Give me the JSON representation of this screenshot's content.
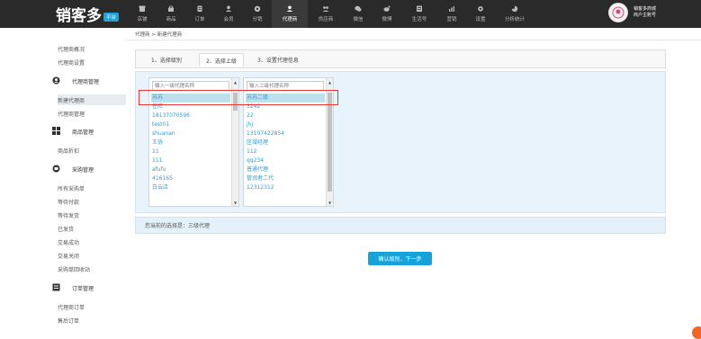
{
  "brand": {
    "name": "销客多",
    "badge": "平台"
  },
  "nav": [
    {
      "label": "店铺",
      "icon": "store-icon"
    },
    {
      "label": "商品",
      "icon": "bag-icon"
    },
    {
      "label": "订单",
      "icon": "order-icon"
    },
    {
      "label": "会员",
      "icon": "member-icon"
    },
    {
      "label": "分销",
      "icon": "distribution-icon"
    },
    {
      "label": "代理商",
      "icon": "agent-icon",
      "active": true
    },
    {
      "label": "供应商",
      "icon": "supplier-icon"
    },
    {
      "label": "微信",
      "icon": "wechat-icon"
    },
    {
      "label": "微博",
      "icon": "weibo-icon"
    },
    {
      "label": "生活号",
      "icon": "life-icon"
    },
    {
      "label": "营销",
      "icon": "marketing-icon"
    },
    {
      "label": "设置",
      "icon": "gear-icon"
    },
    {
      "label": "分析统计",
      "icon": "stats-icon"
    }
  ],
  "user": {
    "line1": "销客多商城",
    "line2": "商户主账号"
  },
  "sidebar": {
    "top_links": [
      "代理商概况",
      "代理商设置"
    ],
    "groups": [
      {
        "title": "代理商管理",
        "icon": "agent-mgmt-icon",
        "links": [
          "新建代理商",
          "代理商管理"
        ]
      },
      {
        "title": "商品管理",
        "icon": "grid-icon",
        "links": [
          "商品折扣"
        ]
      },
      {
        "title": "采购管理",
        "icon": "purchase-icon",
        "links": [
          "所有采购单",
          "等待付款",
          "等待发货",
          "已发货",
          "交易成功",
          "交易关闭",
          "采购单回收站"
        ]
      },
      {
        "title": "订单管理",
        "icon": "doc-icon",
        "links": [
          "代理商订单",
          "售后订单"
        ]
      }
    ],
    "active": "新建代理商"
  },
  "breadcrumb": "代理商 > 新建代理商",
  "tabs": [
    "1、选择级别",
    "2、选择上级",
    "3、设置代理信息"
  ],
  "selector": {
    "col1": {
      "placeholder": "输入一级代理名称",
      "items": [
        "苏苏",
        "任旺",
        "18137070596",
        "test01",
        "shuanan",
        "王协",
        "11",
        "111",
        "afufu",
        "416165",
        "白云店"
      ]
    },
    "col2": {
      "placeholder": "输入二级代理名称",
      "items": [
        "苏苏二级",
        "3242",
        "22",
        "jhj",
        "13107422854",
        "区域经理",
        "112",
        "qq234",
        "普通代理",
        "管润者二代",
        "12312312"
      ]
    }
  },
  "current_selection": "您当前的选择是：三级代理",
  "confirm_label": "确认级别，下一步"
}
